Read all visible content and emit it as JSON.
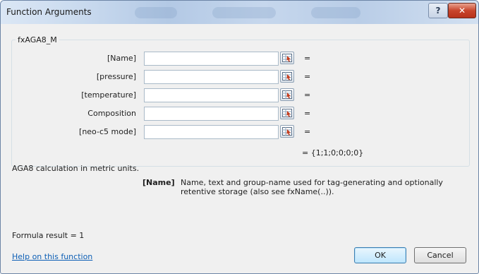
{
  "window": {
    "title": "Function Arguments",
    "help_symbol": "?",
    "close_symbol": "✕"
  },
  "function": {
    "name": "fxAGA8_M",
    "arguments": [
      {
        "label": "[Name]",
        "value": "",
        "equals": "="
      },
      {
        "label": "[pressure]",
        "value": "",
        "equals": "="
      },
      {
        "label": "[temperature]",
        "value": "",
        "equals": "="
      },
      {
        "label": "Composition",
        "value": "",
        "equals": "="
      },
      {
        "label": "[neo-c5 mode]",
        "value": "",
        "equals": "="
      }
    ],
    "result_preview": "=  {1;1;0;0;0;0}",
    "description": "AGA8 calculation in metric units.",
    "param_name": "[Name]",
    "param_description": "Name, text and group-name used for tag-generating and optionally retentive storage (also see fxName(..))."
  },
  "footer": {
    "formula_result": "Formula result =  1",
    "help_link": "Help on this function",
    "ok_label": "OK",
    "cancel_label": "Cancel"
  },
  "icons": {
    "ref_button_icon": "range-selector-icon"
  }
}
